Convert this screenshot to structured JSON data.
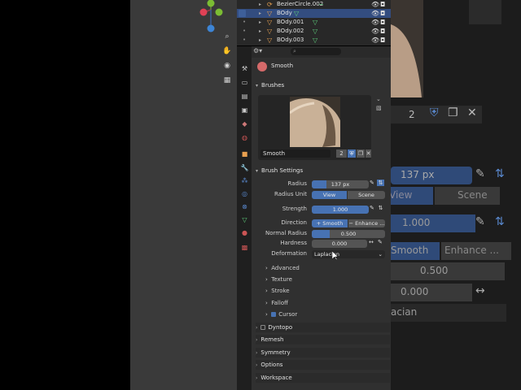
{
  "outliner": {
    "rows": [
      {
        "name": "BezierCircle.002",
        "selected": false
      },
      {
        "name": "BOdy",
        "selected": true
      },
      {
        "name": "BOdy.001",
        "selected": false
      },
      {
        "name": "BOdy.002",
        "selected": false
      },
      {
        "name": "BOdy.003",
        "selected": false
      }
    ]
  },
  "search": {
    "placeholder": ""
  },
  "tool": {
    "name": "Smooth"
  },
  "brushes": {
    "header": "Brushes",
    "brush_name": "Smooth",
    "user_count": "2"
  },
  "brush_settings": {
    "header": "Brush Settings",
    "radius_label": "Radius",
    "radius_value": "137 px",
    "radius_unit_label": "Radius Unit",
    "radius_unit_options": [
      "View",
      "Scene"
    ],
    "strength_label": "Strength",
    "strength_value": "1.000",
    "direction_label": "Direction",
    "direction_options": [
      "Smooth",
      "Enhance ..."
    ],
    "normal_radius_label": "Normal Radius",
    "normal_radius_value": "0.500",
    "hardness_label": "Hardness",
    "hardness_value": "0.000",
    "deformation_label": "Deformation",
    "deformation_value": "Laplacian"
  },
  "subpanels": [
    "Advanced",
    "Texture",
    "Stroke",
    "Falloff",
    "Cursor"
  ],
  "panels": [
    "Dyntopo",
    "Remesh",
    "Symmetry",
    "Options",
    "Workspace"
  ],
  "background_zoom": {
    "count": "2",
    "radius_value": "137 px",
    "unit_options": [
      "View",
      "Scene"
    ],
    "strength_value": "1.000",
    "direction_options": [
      "Smooth",
      "Enhance ..."
    ],
    "normal_radius_value": "0.500",
    "hardness_value": "0.000",
    "deformation_value": "acian"
  },
  "colors": {
    "accent": "#4772b3",
    "panel": "#303030",
    "header": "#2a2a2a"
  }
}
